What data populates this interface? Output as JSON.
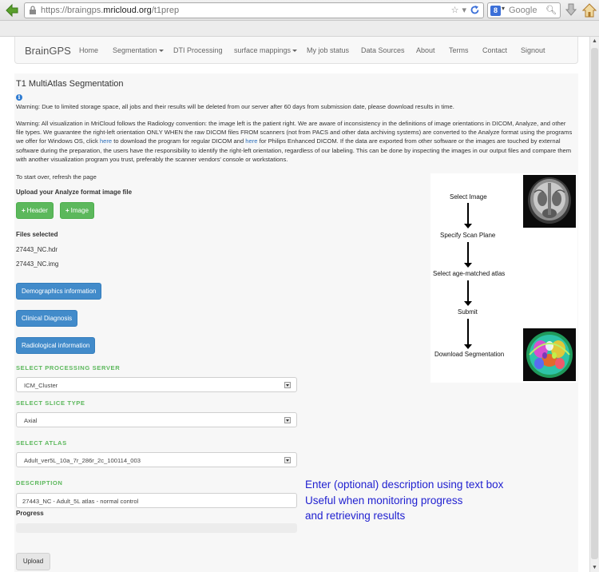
{
  "browser": {
    "url_prefix": "https://braingps.",
    "url_domain": "mricloud.org",
    "url_path": "/t1prep",
    "search_placeholder": "Google",
    "search_engine_badge": "8",
    "icons": [
      "back-arrow-icon",
      "lock-icon",
      "bookmark-star-icon",
      "reload-icon",
      "search-icon",
      "download-icon",
      "home-icon"
    ]
  },
  "nav": {
    "brand": "BrainGPS",
    "items": [
      {
        "label": "Home",
        "dropdown": false
      },
      {
        "label": "Segmentation",
        "dropdown": true
      },
      {
        "label": "DTI Processing",
        "dropdown": false
      },
      {
        "label": "surface mappings",
        "dropdown": true
      },
      {
        "label": "My job status",
        "dropdown": false
      },
      {
        "label": "Data Sources",
        "dropdown": false
      },
      {
        "label": "About",
        "dropdown": false
      },
      {
        "label": "Terms",
        "dropdown": false
      },
      {
        "label": "Contact",
        "dropdown": false
      },
      {
        "label": "Signout",
        "dropdown": false
      }
    ]
  },
  "page": {
    "title": "T1 MultiAtlas Segmentation",
    "info_glyph": "i",
    "warning_storage": "Warning: Due to limited storage space, all jobs and their results will be deleted from our server after 60 days from submission date, please download results in time.",
    "warning_orientation": {
      "part1": "Warning: All visualization in MriCloud follows the Radiology convention: the image left is the patient right. We are aware of inconsistency in the definitions of image orientations in DICOM, Analyze, and other file types. We guarantee the right-left orientation ONLY WHEN the raw DICOM files FROM scanners (not from PACS and other data archiving systems) are converted to the Analyze format using the programs we offer for Windows OS, click ",
      "link1": "here",
      "part2": " to download the program for regular DICOM and ",
      "link2": "here",
      "part3": " for Philips Enhanced DICOM. If the data are exported from other software or the images are touched by external software during the preparation, the users have the responsibility to identify the right-left orientation, regardless of our labeling. This can be done by inspecting the images in our output files and compare them with another visualization program you trust, preferably the scanner vendors' console or workstations."
    },
    "restart_note": "To start over, refresh the page",
    "upload_label": "Upload your Analyze format image file",
    "header_button": "Header",
    "image_button": "Image",
    "plus_glyph": "+",
    "files_label": "Files selected",
    "files": [
      "27443_NC.hdr",
      "27443_NC.img"
    ],
    "demographics_button": "Demographics information",
    "clinical_button": "Clinical Diagnosis",
    "radiological_button": "Radiological information",
    "server_label": "SELECT PROCESSING SERVER",
    "server_value": "ICM_Cluster",
    "slice_label": "SELECT SLICE TYPE",
    "slice_value": "Axial",
    "atlas_label": "SELECT ATLAS",
    "atlas_value": "Adult_ver5L_10a_7r_286r_2c_100114_003",
    "description_label": "DESCRIPTION",
    "description_value": "27443_NC  - Adult_5L atlas - normal control",
    "progress_label": "Progress",
    "progress_value": 0,
    "upload_button": "Upload"
  },
  "annotation": {
    "line1": "Enter (optional) description using text box",
    "line2": "Useful when monitoring progress",
    "line3": "and retrieving results"
  },
  "workflow": {
    "steps": [
      "Select Image",
      "Specify Scan Plane",
      "Select age-matched atlas",
      "Submit",
      "Download Segmentation"
    ],
    "images": [
      "mri-brain-slice-image",
      "segmented-brain-image"
    ]
  },
  "colors": {
    "green_button": "#5cb85c",
    "blue_button": "#428bca",
    "section_label": "#5cb85c",
    "annotation_text": "#1f1fd0",
    "link": "#2a6db9"
  }
}
